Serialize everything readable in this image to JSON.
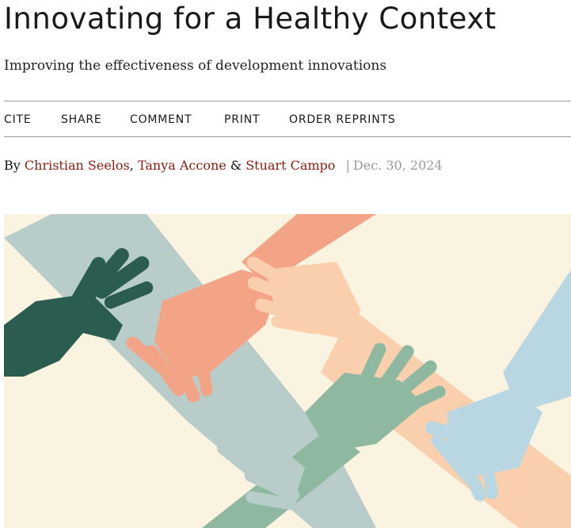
{
  "article": {
    "title": "Innovating for a Healthy Context",
    "subtitle": "Improving the effectiveness of development innovations",
    "actions": [
      "CITE",
      "SHARE",
      "COMMENT",
      "PRINT",
      "ORDER REPRINTS"
    ],
    "byline_prefix": "By",
    "authors": [
      "Christian Seelos",
      "Tanya Accone",
      "Stuart Campo"
    ],
    "author_sep_1": ",",
    "author_sep_2": "&",
    "date_sep": "|",
    "date": "Dec. 30, 2024"
  },
  "hero": {
    "icon": "joined-hands-illustration",
    "colors": {
      "background": "#faf3e0",
      "dark_green": "#2a5c50",
      "grey_blue": "#b8cdca",
      "salmon": "#f3a487",
      "peach": "#f9cfad",
      "sage": "#8fb8a0",
      "light_blue": "#b9d7e2"
    }
  }
}
